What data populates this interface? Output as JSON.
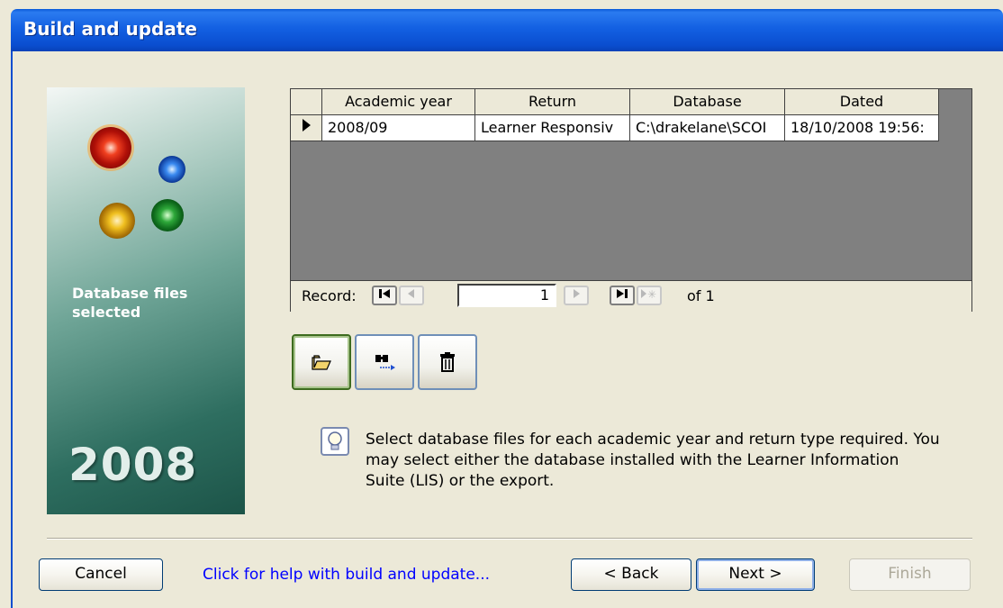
{
  "window": {
    "title": "Build and update"
  },
  "sidebar": {
    "label": "Database files\nselected",
    "year": "2008"
  },
  "grid": {
    "columns": [
      "Academic year",
      "Return",
      "Database",
      "Dated"
    ],
    "rows": [
      {
        "academic_year": "2008/09",
        "return": "Learner Responsiv",
        "database": "C:\\drakelane\\SCOI",
        "dated": "18/10/2008 19:56:"
      }
    ],
    "nav": {
      "label": "Record:",
      "current": "1",
      "of_label": "of 1"
    }
  },
  "toolbar": {
    "open_icon": "folder-open-icon",
    "find_icon": "binoculars-icon",
    "delete_icon": "trash-icon"
  },
  "hint": {
    "icon": "lightbulb-icon",
    "text": "Select database files for each academic year and return type required. You may select either the database installed with the Learner Information Suite (LIS) or the export."
  },
  "buttons": {
    "cancel": "Cancel",
    "help": "Click for help with build and update...",
    "back": "< Back",
    "next": "Next >",
    "finish": "Finish"
  },
  "colors": {
    "titlebar": "#0a5ad8",
    "dialog": "#ece9d8",
    "link": "#0000ff"
  }
}
